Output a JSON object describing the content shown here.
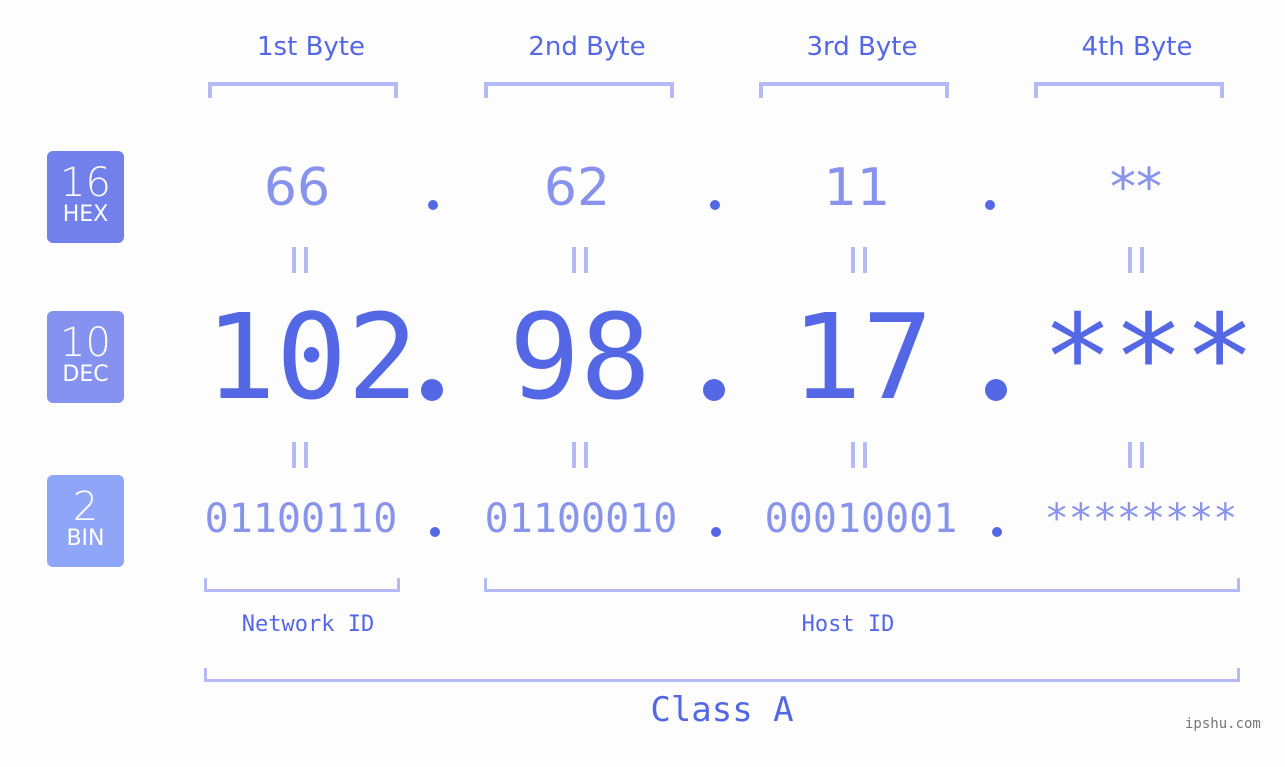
{
  "bytes": {
    "labels": [
      "1st Byte",
      "2nd Byte",
      "3rd Byte",
      "4th Byte"
    ]
  },
  "badges": {
    "hex": {
      "number": "16",
      "label": "HEX",
      "color": "#7280ec"
    },
    "dec": {
      "number": "10",
      "label": "DEC",
      "color": "#8592f0"
    },
    "bin": {
      "number": "2",
      "label": "BIN",
      "color": "#8fa6f8"
    }
  },
  "hex": {
    "values": [
      "66",
      "62",
      "11",
      "**"
    ]
  },
  "dec": {
    "values": [
      "102",
      "98",
      "17",
      "***"
    ]
  },
  "bin": {
    "values": [
      "01100110",
      "01100010",
      "00010001",
      "********"
    ]
  },
  "sections": {
    "network_id": "Network ID",
    "host_id": "Host ID",
    "class": "Class A"
  },
  "watermark": "ipshu.com",
  "colors": {
    "primary": "#5468e6",
    "light": "#8893ee",
    "bracket": "#b3baf5"
  }
}
